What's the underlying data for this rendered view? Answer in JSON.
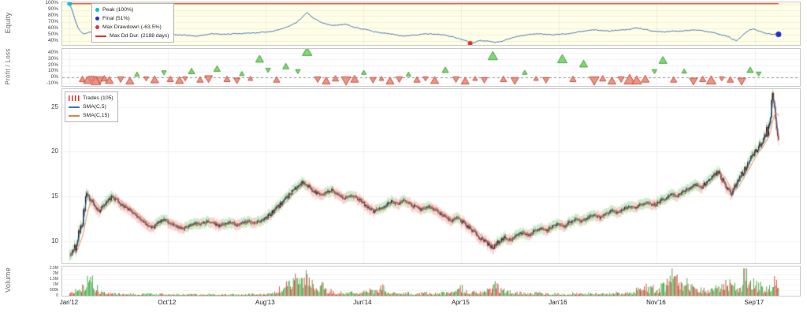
{
  "x_axis": {
    "labels": [
      "Jan'12",
      "Oct'12",
      "Aug'13",
      "Jun'14",
      "Apr'15",
      "Jan'16",
      "Nov'16",
      "Sep'17"
    ],
    "fractions": [
      0.01,
      0.143,
      0.276,
      0.408,
      0.541,
      0.673,
      0.806,
      0.939
    ],
    "data_window": [
      0.01,
      0.971
    ]
  },
  "chart_data": [
    {
      "type": "line",
      "name": "equity-curve",
      "ylabel": "Equity",
      "background": "#fffee7",
      "line_color": "#3f74ba",
      "ylim": [
        34,
        102
      ],
      "ytick_values": [
        100,
        90,
        80,
        70,
        60,
        50,
        40
      ],
      "ytick_labels": [
        "100%",
        "90%",
        "80%",
        "70%",
        "60%",
        "50%",
        "40%"
      ],
      "legend": [
        {
          "label": "Peak (100%)",
          "color": "#00c0dd",
          "marker": "dot"
        },
        {
          "label": "Final (51%)",
          "color": "#1f2fd0",
          "marker": "dot"
        },
        {
          "label": "Max Drawdown (-63.5%)",
          "color": "#e03226",
          "marker": "dot"
        },
        {
          "label": "Max Dd Dur. (2188 days)",
          "color": "#e03226",
          "marker": "line"
        }
      ],
      "max_dd_duration_line": {
        "value": 100,
        "f0": 0.0,
        "f1": 1.0,
        "color": "#e03226"
      },
      "markers": {
        "peak": {
          "f": 0.0,
          "v": 100,
          "color": "#00c0dd"
        },
        "final": {
          "f": 1.0,
          "v": 51,
          "color": "#1f2fd0"
        },
        "max_drawdown": {
          "f": 0.565,
          "v": 36.5,
          "color": "#e03226"
        }
      },
      "point_format": "[x_fraction, equity_pct]",
      "points": [
        [
          0,
          100
        ],
        [
          0.004,
          88
        ],
        [
          0.008,
          73
        ],
        [
          0.012,
          61
        ],
        [
          0.016,
          55
        ],
        [
          0.02,
          52
        ],
        [
          0.03,
          55
        ],
        [
          0.04,
          57
        ],
        [
          0.05,
          56
        ],
        [
          0.06,
          58
        ],
        [
          0.07,
          57
        ],
        [
          0.08,
          58
        ],
        [
          0.09,
          56
        ],
        [
          0.1,
          54
        ],
        [
          0.11,
          53
        ],
        [
          0.12,
          52
        ],
        [
          0.13,
          52
        ],
        [
          0.14,
          51
        ],
        [
          0.15,
          50
        ],
        [
          0.16,
          50
        ],
        [
          0.17,
          49
        ],
        [
          0.18,
          48
        ],
        [
          0.19,
          50
        ],
        [
          0.2,
          52
        ],
        [
          0.21,
          51
        ],
        [
          0.22,
          51
        ],
        [
          0.23,
          52
        ],
        [
          0.24,
          52
        ],
        [
          0.25,
          53
        ],
        [
          0.26,
          53
        ],
        [
          0.27,
          54
        ],
        [
          0.28,
          55
        ],
        [
          0.29,
          57
        ],
        [
          0.3,
          60
        ],
        [
          0.31,
          64
        ],
        [
          0.32,
          70
        ],
        [
          0.33,
          80
        ],
        [
          0.335,
          86
        ],
        [
          0.34,
          80
        ],
        [
          0.35,
          73
        ],
        [
          0.36,
          68
        ],
        [
          0.37,
          65
        ],
        [
          0.38,
          66
        ],
        [
          0.39,
          67
        ],
        [
          0.4,
          63
        ],
        [
          0.41,
          60
        ],
        [
          0.42,
          58
        ],
        [
          0.43,
          55
        ],
        [
          0.44,
          53
        ],
        [
          0.45,
          52
        ],
        [
          0.46,
          50
        ],
        [
          0.47,
          48
        ],
        [
          0.48,
          49
        ],
        [
          0.49,
          50
        ],
        [
          0.5,
          52
        ],
        [
          0.52,
          51
        ],
        [
          0.53,
          50
        ],
        [
          0.54,
          47
        ],
        [
          0.55,
          44
        ],
        [
          0.56,
          41
        ],
        [
          0.565,
          36.5
        ],
        [
          0.57,
          38
        ],
        [
          0.58,
          41
        ],
        [
          0.59,
          40
        ],
        [
          0.6,
          38
        ],
        [
          0.61,
          40
        ],
        [
          0.62,
          44
        ],
        [
          0.63,
          47
        ],
        [
          0.64,
          49
        ],
        [
          0.65,
          51
        ],
        [
          0.66,
          52
        ],
        [
          0.67,
          51
        ],
        [
          0.68,
          50
        ],
        [
          0.69,
          51
        ],
        [
          0.7,
          52
        ],
        [
          0.71,
          53
        ],
        [
          0.72,
          55
        ],
        [
          0.73,
          57
        ],
        [
          0.74,
          58
        ],
        [
          0.75,
          57
        ],
        [
          0.76,
          56
        ],
        [
          0.77,
          57
        ],
        [
          0.78,
          58
        ],
        [
          0.79,
          59
        ],
        [
          0.8,
          61
        ],
        [
          0.81,
          59
        ],
        [
          0.82,
          57
        ],
        [
          0.83,
          55
        ],
        [
          0.84,
          55
        ],
        [
          0.85,
          56
        ],
        [
          0.86,
          56
        ],
        [
          0.87,
          57
        ],
        [
          0.88,
          58
        ],
        [
          0.89,
          57
        ],
        [
          0.9,
          55
        ],
        [
          0.91,
          53
        ],
        [
          0.92,
          50
        ],
        [
          0.93,
          47
        ],
        [
          0.935,
          43
        ],
        [
          0.94,
          41
        ],
        [
          0.945,
          44
        ],
        [
          0.95,
          50
        ],
        [
          0.955,
          55
        ],
        [
          0.96,
          58
        ],
        [
          0.965,
          60
        ],
        [
          0.97,
          57
        ],
        [
          0.975,
          55
        ],
        [
          0.98,
          53
        ],
        [
          0.985,
          52
        ],
        [
          0.99,
          51
        ],
        [
          1,
          51
        ]
      ]
    },
    {
      "type": "scatter",
      "name": "profit-loss",
      "ylabel": "Profit / Loss",
      "ylim": [
        -14,
        47
      ],
      "ytick_values": [
        40,
        30,
        20,
        10,
        0,
        -10
      ],
      "ytick_labels": [
        "40%",
        "30%",
        "20%",
        "10%",
        "0%",
        "-10%"
      ],
      "zero_line": 0,
      "colors": {
        "profit_fill": "#7fd96f",
        "profit_edge": "#2f8f2f",
        "loss_fill": "#ed9484",
        "loss_edge": "#bf3a2b"
      },
      "point_format": "[x_fraction, pnl_pct, direction(1=up,-1=down), profit(1)/loss(0), size_px]",
      "points": [
        [
          0.018,
          -3,
          1,
          0,
          4
        ],
        [
          0.025,
          -5,
          1,
          0,
          5
        ],
        [
          0.031,
          -2,
          -1,
          0,
          4
        ],
        [
          0.037,
          -6,
          1,
          0,
          6
        ],
        [
          0.043,
          -4,
          -1,
          0,
          5
        ],
        [
          0.049,
          -2,
          1,
          0,
          4
        ],
        [
          0.056,
          -5,
          1,
          0,
          5
        ],
        [
          0.072,
          -3,
          -1,
          0,
          4
        ],
        [
          0.085,
          -6,
          1,
          0,
          5
        ],
        [
          0.095,
          5,
          1,
          1,
          3
        ],
        [
          0.108,
          -2,
          -1,
          0,
          3
        ],
        [
          0.12,
          -4,
          1,
          0,
          5
        ],
        [
          0.133,
          8,
          -1,
          1,
          3
        ],
        [
          0.142,
          -3,
          1,
          0,
          4
        ],
        [
          0.155,
          -5,
          1,
          0,
          5
        ],
        [
          0.163,
          -2,
          -1,
          0,
          3
        ],
        [
          0.172,
          10,
          1,
          1,
          4
        ],
        [
          0.184,
          -4,
          1,
          0,
          4
        ],
        [
          0.196,
          -2,
          -1,
          0,
          5
        ],
        [
          0.208,
          14,
          1,
          1,
          4
        ],
        [
          0.222,
          -3,
          1,
          0,
          4
        ],
        [
          0.236,
          -5,
          -1,
          0,
          4
        ],
        [
          0.243,
          6,
          1,
          1,
          3
        ],
        [
          0.255,
          -2,
          1,
          0,
          3
        ],
        [
          0.268,
          30,
          1,
          1,
          5
        ],
        [
          0.28,
          12,
          -1,
          1,
          3
        ],
        [
          0.292,
          -4,
          1,
          0,
          4
        ],
        [
          0.305,
          18,
          1,
          1,
          4
        ],
        [
          0.322,
          10,
          -1,
          1,
          3
        ],
        [
          0.335,
          42,
          1,
          1,
          6
        ],
        [
          0.35,
          -3,
          -1,
          0,
          4
        ],
        [
          0.362,
          -6,
          1,
          0,
          5
        ],
        [
          0.375,
          -2,
          1,
          0,
          4
        ],
        [
          0.39,
          -5,
          -1,
          0,
          6
        ],
        [
          0.402,
          -3,
          1,
          0,
          5
        ],
        [
          0.415,
          8,
          1,
          1,
          3
        ],
        [
          0.428,
          -4,
          -1,
          0,
          4
        ],
        [
          0.44,
          -2,
          1,
          0,
          3
        ],
        [
          0.452,
          -6,
          1,
          0,
          5
        ],
        [
          0.465,
          -3,
          -1,
          0,
          4
        ],
        [
          0.478,
          5,
          1,
          1,
          3
        ],
        [
          0.49,
          -4,
          1,
          0,
          4
        ],
        [
          0.502,
          -2,
          -1,
          0,
          3
        ],
        [
          0.515,
          -5,
          1,
          0,
          5
        ],
        [
          0.53,
          12,
          1,
          1,
          4
        ],
        [
          0.545,
          -3,
          -1,
          0,
          4
        ],
        [
          0.558,
          -6,
          1,
          0,
          5
        ],
        [
          0.572,
          -2,
          1,
          0,
          3
        ],
        [
          0.585,
          -4,
          -1,
          0,
          4
        ],
        [
          0.597,
          35,
          1,
          1,
          6
        ],
        [
          0.612,
          -3,
          1,
          0,
          4
        ],
        [
          0.628,
          -5,
          -1,
          0,
          5
        ],
        [
          0.642,
          8,
          1,
          1,
          3
        ],
        [
          0.658,
          -2,
          1,
          0,
          3
        ],
        [
          0.672,
          -4,
          -1,
          0,
          4
        ],
        [
          0.695,
          30,
          1,
          1,
          6
        ],
        [
          0.71,
          -3,
          1,
          0,
          4
        ],
        [
          0.725,
          22,
          1,
          1,
          5
        ],
        [
          0.74,
          -5,
          -1,
          0,
          6
        ],
        [
          0.752,
          -2,
          1,
          0,
          4
        ],
        [
          0.765,
          -6,
          1,
          0,
          5
        ],
        [
          0.778,
          -3,
          -1,
          0,
          4
        ],
        [
          0.79,
          -4,
          1,
          0,
          7
        ],
        [
          0.8,
          -5,
          1,
          0,
          6
        ],
        [
          0.812,
          -3,
          1,
          0,
          5
        ],
        [
          0.825,
          10,
          -1,
          1,
          3
        ],
        [
          0.837,
          28,
          1,
          1,
          5
        ],
        [
          0.852,
          -4,
          1,
          0,
          4
        ],
        [
          0.867,
          10,
          1,
          1,
          3
        ],
        [
          0.88,
          -6,
          -1,
          0,
          5
        ],
        [
          0.893,
          -3,
          1,
          0,
          4
        ],
        [
          0.905,
          -5,
          1,
          0,
          6
        ],
        [
          0.92,
          -2,
          -1,
          0,
          3
        ],
        [
          0.932,
          -4,
          1,
          0,
          4
        ],
        [
          0.948,
          -6,
          -1,
          0,
          5
        ],
        [
          0.96,
          12,
          1,
          1,
          4
        ],
        [
          0.972,
          6,
          -1,
          1,
          3
        ]
      ]
    },
    {
      "type": "candlestick",
      "name": "price",
      "ylim": [
        7.5,
        27
      ],
      "ytick_values": [
        25,
        20,
        15,
        10
      ],
      "ytick_labels": [
        "25",
        "20",
        "15",
        "10"
      ],
      "legend": [
        {
          "label": "Trades (105)",
          "color": "#e03226",
          "marker": "hatch"
        },
        {
          "label": "SMA(C,5)",
          "color": "#3f74ba",
          "marker": "line"
        },
        {
          "label": "SMA(C,15)",
          "color": "#e2833f",
          "marker": "line"
        }
      ],
      "trades_count": 105,
      "sma_fast_period": 5,
      "sma_slow_period": 15,
      "sma_fast_color": "#3f74ba",
      "sma_slow_color": "#e2833f",
      "band_colors": {
        "long": "rgba(87,190,79,0.28)",
        "short": "rgba(238,120,100,0.30)"
      },
      "candle_colors": {
        "up": "#1c1c1c",
        "down": "#9e3428"
      },
      "close": [
        8.5,
        9.5,
        12.0,
        15.2,
        14.0,
        13.4,
        14.2,
        14.9,
        14.5,
        13.9,
        13.5,
        12.9,
        12.4,
        11.8,
        11.5,
        12.1,
        12.4,
        11.9,
        11.6,
        11.3,
        11.7,
        12.0,
        11.8,
        12.2,
        12.0,
        11.7,
        11.9,
        12.1,
        11.8,
        12.0,
        12.2,
        12.0,
        12.3,
        12.6,
        13.2,
        13.8,
        14.6,
        15.3,
        15.9,
        16.6,
        16.2,
        15.6,
        15.1,
        15.4,
        15.7,
        15.2,
        14.8,
        15.1,
        14.9,
        14.4,
        13.8,
        13.3,
        13.6,
        14.0,
        14.4,
        14.1,
        14.5,
        14.2,
        13.8,
        13.5,
        13.9,
        13.6,
        13.1,
        12.7,
        12.2,
        12.6,
        12.1,
        11.5,
        10.9,
        10.3,
        9.8,
        9.2,
        9.9,
        10.4,
        10.1,
        10.6,
        10.9,
        10.7,
        11.1,
        11.4,
        11.2,
        11.6,
        11.9,
        11.7,
        12.1,
        12.4,
        12.2,
        12.6,
        12.9,
        12.7,
        13.1,
        13.4,
        13.2,
        13.6,
        13.9,
        13.7,
        14.1,
        14.3,
        14.0,
        14.4,
        14.8,
        15.2,
        15.0,
        15.5,
        15.9,
        16.3,
        16.0,
        16.6,
        17.2,
        17.8,
        16.2,
        15.3,
        16.4,
        17.6,
        18.8,
        19.8,
        20.9,
        22.0,
        25.6,
        21.3
      ]
    },
    {
      "type": "bar",
      "name": "volume",
      "ylabel": "Volume",
      "ylim": [
        0,
        1.08
      ],
      "ytick_values": [
        1.0,
        0.8,
        0.6,
        0.4,
        0.2,
        0
      ],
      "ytick_labels": [
        "2.5M",
        "2M",
        "1.5M",
        "1M",
        "500k",
        "0"
      ],
      "colors": {
        "up": "#4fae4f",
        "down": "#d45848"
      },
      "values": [
        0.1,
        0.18,
        0.3,
        0.55,
        0.32,
        0.12,
        0.08,
        0.1,
        0.07,
        0.06,
        0.08,
        0.05,
        0.07,
        0.09,
        0.06,
        0.08,
        0.05,
        0.04,
        0.06,
        0.05,
        0.07,
        0.05,
        0.04,
        0.06,
        0.05,
        0.04,
        0.05,
        0.06,
        0.04,
        0.05,
        0.06,
        0.05,
        0.07,
        0.1,
        0.14,
        0.3,
        0.45,
        0.6,
        0.95,
        0.8,
        0.5,
        0.35,
        0.4,
        0.22,
        0.15,
        0.12,
        0.1,
        0.12,
        0.09,
        0.14,
        0.2,
        0.16,
        0.35,
        0.12,
        0.1,
        0.08,
        0.1,
        0.07,
        0.08,
        0.1,
        0.08,
        0.09,
        0.12,
        0.1,
        0.13,
        0.3,
        0.18,
        0.14,
        0.12,
        0.15,
        0.2,
        0.4,
        0.25,
        0.15,
        0.1,
        0.12,
        0.09,
        0.08,
        0.1,
        0.08,
        0.09,
        0.1,
        0.08,
        0.07,
        0.09,
        0.08,
        0.07,
        0.09,
        0.08,
        0.1,
        0.09,
        0.11,
        0.09,
        0.12,
        0.1,
        0.28,
        0.35,
        0.3,
        0.25,
        0.4,
        0.55,
        0.85,
        0.45,
        0.6,
        0.38,
        0.3,
        0.22,
        0.25,
        0.3,
        0.35,
        0.5,
        0.4,
        0.3,
        0.9,
        0.65,
        0.45,
        0.35,
        0.3,
        0.6,
        0.25
      ]
    }
  ]
}
